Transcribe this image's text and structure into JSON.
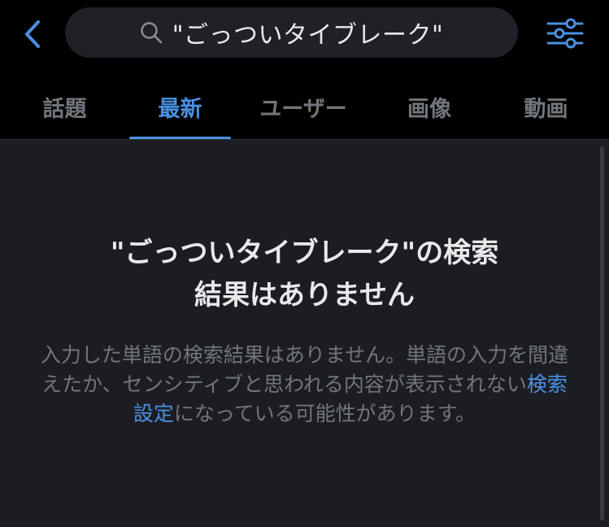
{
  "header": {
    "back_icon": "chevron-left-icon",
    "search": {
      "icon": "search-icon",
      "query": "\"ごっついタイブレーク\""
    },
    "filter_icon": "sliders-icon",
    "accent_color": "#4a90e2"
  },
  "tabs": [
    {
      "label": "話題",
      "active": false
    },
    {
      "label": "最新",
      "active": true
    },
    {
      "label": "ユーザー",
      "active": false
    },
    {
      "label": "画像",
      "active": false
    },
    {
      "label": "動画",
      "active": false
    }
  ],
  "empty_state": {
    "title_line1": "\"ごっついタイブレーク\"の検索",
    "title_line2": "結果はありません",
    "body_part1": "入力した単語の検索結果はありません。単語の入力を間違えたか、センシティブと思われる内容が表示されない",
    "link_text": "検索設定",
    "body_part2": "になっている可能性があります。"
  }
}
